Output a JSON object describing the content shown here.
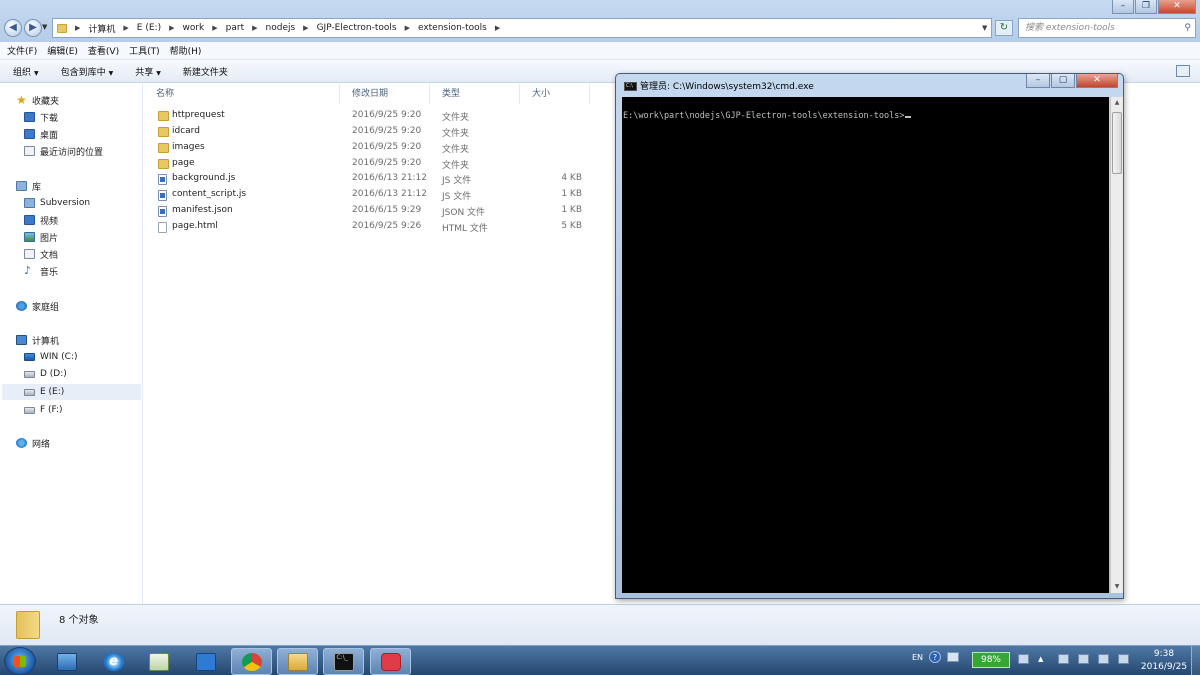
{
  "explorer": {
    "breadcrumbs": [
      "计算机",
      "E (E:)",
      "work",
      "part",
      "nodejs",
      "GJP-Electron-tools",
      "extension-tools"
    ],
    "search_placeholder": "搜索 extension-tools",
    "menu": [
      "文件(F)",
      "编辑(E)",
      "查看(V)",
      "工具(T)",
      "帮助(H)"
    ],
    "toolbar": {
      "organize": "组织",
      "include_in_library": "包含到库中",
      "share": "共享",
      "new_folder": "新建文件夹"
    },
    "nav": {
      "favorites": {
        "label": "收藏夹",
        "items": [
          "下载",
          "桌面",
          "最近访问的位置"
        ]
      },
      "libraries": {
        "label": "库",
        "items": [
          "Subversion",
          "视频",
          "图片",
          "文档",
          "音乐"
        ]
      },
      "homegroup": "家庭组",
      "computer": {
        "label": "计算机",
        "items": [
          "WIN (C:)",
          "D (D:)",
          "E (E:)",
          "F (F:)"
        ]
      },
      "network": "网络"
    },
    "columns": {
      "name": "名称",
      "date": "修改日期",
      "type": "类型",
      "size": "大小"
    },
    "files": [
      {
        "name": "httprequest",
        "date": "2016/9/25 9:20",
        "type": "文件夹",
        "size": "",
        "icon": "folder-icon"
      },
      {
        "name": "idcard",
        "date": "2016/9/25 9:20",
        "type": "文件夹",
        "size": "",
        "icon": "folder-icon"
      },
      {
        "name": "images",
        "date": "2016/9/25 9:20",
        "type": "文件夹",
        "size": "",
        "icon": "folder-icon"
      },
      {
        "name": "page",
        "date": "2016/9/25 9:20",
        "type": "文件夹",
        "size": "",
        "icon": "folder-icon"
      },
      {
        "name": "background.js",
        "date": "2016/6/13 21:12",
        "type": "JS 文件",
        "size": "4 KB",
        "icon": "js-file-icon"
      },
      {
        "name": "content_script.js",
        "date": "2016/6/13 21:12",
        "type": "JS 文件",
        "size": "1 KB",
        "icon": "js-file-icon"
      },
      {
        "name": "manifest.json",
        "date": "2016/6/15 9:29",
        "type": "JSON 文件",
        "size": "1 KB",
        "icon": "json-file-icon"
      },
      {
        "name": "page.html",
        "date": "2016/9/25 9:26",
        "type": "HTML 文件",
        "size": "5 KB",
        "icon": "html-file-icon"
      }
    ],
    "status": "8 个对象"
  },
  "cmd": {
    "title": "管理员: C:\\Windows\\system32\\cmd.exe",
    "prompt": "E:\\work\\part\\nodejs\\GJP-Electron-tools\\extension-tools>"
  },
  "taskbar": {
    "apps": [
      "computer-icon",
      "ie-icon",
      "chart-app-icon",
      "visual-studio-code-icon",
      "chrome-icon",
      "explorer-icon",
      "cmd-icon",
      "camera-app-icon"
    ],
    "language": "EN",
    "battery": "98%",
    "time": "9:38",
    "date": "2016/9/25"
  },
  "colors": {
    "titlebar": "#c6daf0",
    "taskbar": "#24476f",
    "console_bg": "#000000",
    "console_fg": "#c0c0c0",
    "battery": "#36a635"
  }
}
